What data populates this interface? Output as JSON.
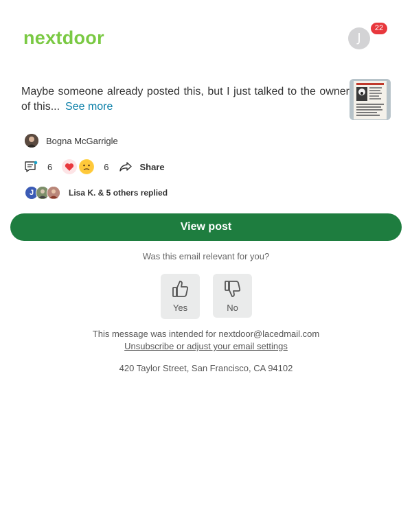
{
  "header": {
    "brand": "nextdoor",
    "brand_color": "#7ac943",
    "avatar_initial": "J",
    "notification_count": "22"
  },
  "post": {
    "excerpt": "Maybe someone already posted this, but I just talked to the owner of this...",
    "see_more": "See more",
    "thumbnail_icon": "lost-pet-flyer-image",
    "author": "Bogna McGarrigle",
    "comment_count": "6",
    "reaction_count": "6",
    "share_label": "Share",
    "replies_avatar_initial": "J",
    "replies_text": "Lisa K. & 5 others replied"
  },
  "cta": {
    "view_post": "View post",
    "accent": "#1e7d3f"
  },
  "feedback": {
    "question": "Was this email relevant for you?",
    "yes": "Yes",
    "no": "No"
  },
  "footer": {
    "intended_prefix": "This message was intended for ",
    "email": "nextdoor@lacedmail.com",
    "unsubscribe": "Unsubscribe or adjust your email settings",
    "address": "420 Taylor Street, San Francisco, CA 94102"
  }
}
